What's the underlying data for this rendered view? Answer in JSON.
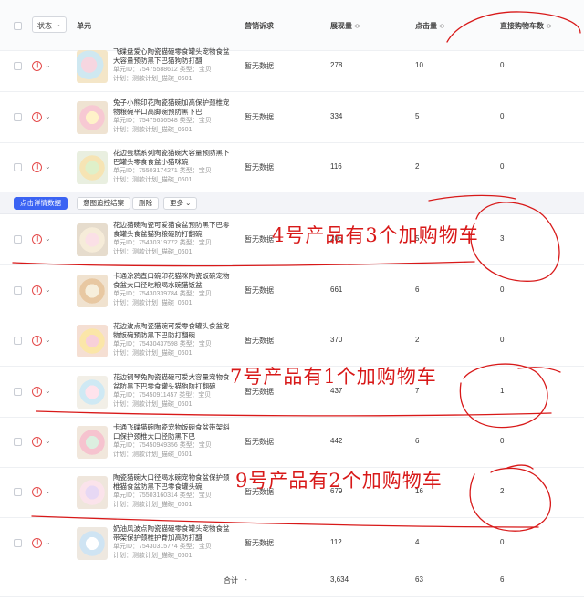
{
  "header": {
    "status_dropdown": "状态",
    "status_chevron": "⌄",
    "col_unit": "单元",
    "col_marketing": "营销诉求",
    "col_impressions": "展现量",
    "col_clicks": "点击量",
    "col_direct_cart": "直接购物车数",
    "sort_icon": "≎"
  },
  "bulk_actions": {
    "detail_button": "点击详情数据",
    "monitor_button": "意图追控结案",
    "delete_button": "删除",
    "more_button": "更多 ⌄"
  },
  "row_icons": {
    "pause": "||",
    "chevron": "⌄"
  },
  "products": [
    {
      "name": "飞碟盘爱心陶瓷猫碗零食罐头宠物食盆大容量预防黑下巴猫狗防打翻",
      "id_line": "单元ID：75475588612  类型：宝贝",
      "plan_line": "计划：测款计划_猫碗_0601",
      "marketing": "暂无数据",
      "impressions": "278",
      "clicks": "10",
      "cart": "0"
    },
    {
      "name": "兔子小熊印花陶瓷猫碗加高保护颈椎宠物粮碗平口高脚碗预防黑下巴",
      "id_line": "单元ID：75475636548  类型：宝贝",
      "plan_line": "计划：测款计划_猫碗_0601",
      "marketing": "暂无数据",
      "impressions": "334",
      "clicks": "5",
      "cart": "0"
    },
    {
      "name": "花边蛋糕系列陶瓷猫碗大容量预防黑下巴罐头零食食盆小猫咪碗",
      "id_line": "单元ID：75503174271  类型：宝贝",
      "plan_line": "计划：测款计划_猫碗_0601",
      "marketing": "暂无数据",
      "impressions": "116",
      "clicks": "2",
      "cart": "0"
    },
    {
      "name": "花边猫碗陶瓷可爱猫食盆预防黑下巴零食罐头食盆猫狗粮碗防打翻碗",
      "id_line": "单元ID：75430319772  类型：宝贝",
      "plan_line": "计划：测款计划_猫碗_0601",
      "marketing": "暂无数据",
      "impressions": "205",
      "clicks": "5",
      "cart": "3"
    },
    {
      "name": "卡通涂鸦直口碗印花猫咪陶瓷饭碗宠物食盆大口径吃粮喝水碗猫饭盆",
      "id_line": "单元ID：75430339784  类型：宝贝",
      "plan_line": "计划：测款计划_猫碗_0601",
      "marketing": "暂无数据",
      "impressions": "661",
      "clicks": "6",
      "cart": "0"
    },
    {
      "name": "花边波点陶瓷猫碗可爱零食罐头食盆宠物饭碗预防黑下巴防打翻碗",
      "id_line": "单元ID：75430437598  类型：宝贝",
      "plan_line": "计划：测款计划_猫碗_0601",
      "marketing": "暂无数据",
      "impressions": "370",
      "clicks": "2",
      "cart": "0"
    },
    {
      "name": "花边钢琴兔陶瓷猫碗可爱大容量宠物食盆防黑下巴零食罐头猫狗防打翻碗",
      "id_line": "单元ID：75450911457  类型：宝贝",
      "plan_line": "计划：测款计划_猫碗_0601",
      "marketing": "暂无数据",
      "impressions": "437",
      "clicks": "7",
      "cart": "1"
    },
    {
      "name": "卡通飞碟猫碗陶瓷宠物饭碗食盆带架斜口保护颈椎大口径防黑下巴",
      "id_line": "单元ID：75450949356  类型：宝贝",
      "plan_line": "计划：测款计划_猫碗_0601",
      "marketing": "暂无数据",
      "impressions": "442",
      "clicks": "6",
      "cart": "0"
    },
    {
      "name": "陶瓷猫碗大口径喝水碗宠物食盆保护颈椎猫食盆防黑下巴零食罐头碗",
      "id_line": "单元ID：75503160314  类型：宝贝",
      "plan_line": "计划：测款计划_猫碗_0601",
      "marketing": "暂无数据",
      "impressions": "679",
      "clicks": "16",
      "cart": "2"
    },
    {
      "name": "奶油风波点陶瓷猫碗零食罐头宠物食盆带架保护颈椎护脊加高防打翻",
      "id_line": "单元ID：75430315774  类型：宝贝",
      "plan_line": "计划：测款计划_猫碗_0601",
      "marketing": "暂无数据",
      "impressions": "112",
      "clicks": "4",
      "cart": "0"
    }
  ],
  "totals": {
    "label": "合计",
    "marketing": "-",
    "impressions": "3,634",
    "clicks": "63",
    "cart": "6"
  },
  "annotations": {
    "note_4": "4号产品有3个加购物车",
    "note_7": "7号产品有1个加购物车",
    "note_9": "9号产品有2个加购物车",
    "ink_color": "#d81919"
  }
}
